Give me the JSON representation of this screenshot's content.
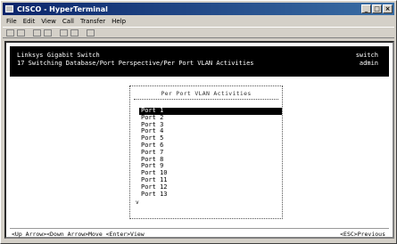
{
  "window": {
    "title": "CISCO - HyperTerminal",
    "menu": [
      "File",
      "Edit",
      "View",
      "Call",
      "Transfer",
      "Help"
    ]
  },
  "header": {
    "line1": "Linksys Gigabit Switch",
    "line2": "17 Switching Database/Port Perspective/Per Port VLAN Activities",
    "right1": "switch",
    "right2": "admin"
  },
  "panel": {
    "title": "Per Port VLAN Activities",
    "ports": [
      "Port 1",
      "Port 2",
      "Port 3",
      "Port 4",
      "Port 5",
      "Port 6",
      "Port 7",
      "Port 8",
      "Port 9",
      "Port 10",
      "Port 11",
      "Port 12",
      "Port 13"
    ],
    "selected_index": 0,
    "more_indicator": "v"
  },
  "footer": {
    "left": "<Up Arrow><Down Arrow>Move <Enter>View",
    "right": "<ESC>Previous"
  }
}
